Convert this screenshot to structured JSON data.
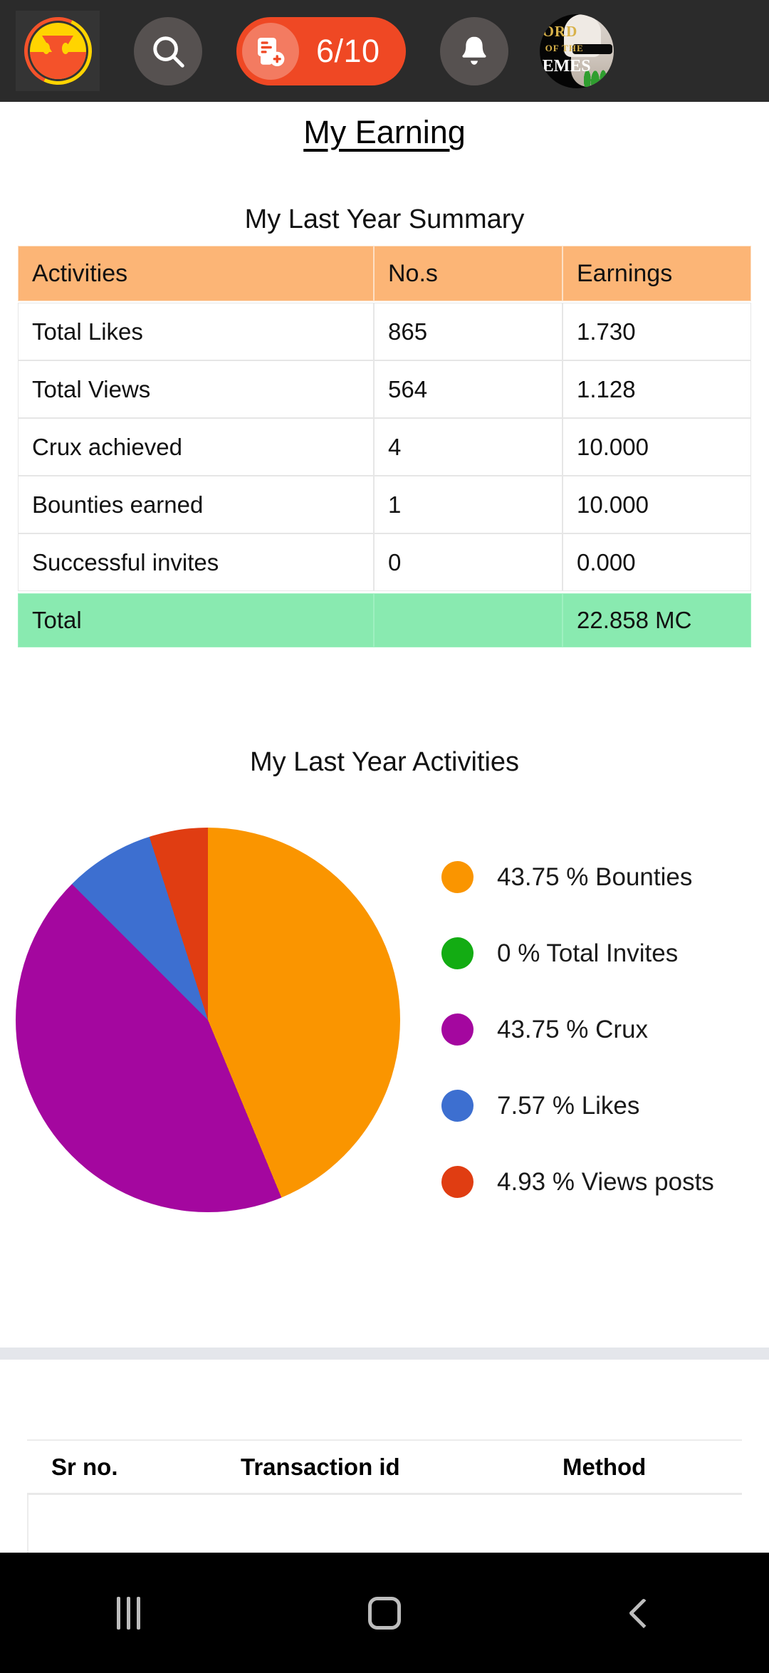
{
  "appbar": {
    "logo_name": "app-logo-owl",
    "search_icon": "search-icon",
    "post_icon": "add-post-icon",
    "post_count": "6/10",
    "bell_icon": "notification-bell-icon",
    "avatar_line1": "ORD",
    "avatar_line2": "OF THE",
    "avatar_line3": "EMES"
  },
  "page": {
    "title": "My Earning",
    "summary_heading": "My Last Year Summary",
    "activities_heading": "My Last Year Activities"
  },
  "summary_table": {
    "columns": [
      "Activities",
      "No.s",
      "Earnings"
    ],
    "rows": [
      {
        "activity": "Total Likes",
        "nos": "865",
        "earnings": "1.730"
      },
      {
        "activity": "Total Views",
        "nos": "564",
        "earnings": "1.128"
      },
      {
        "activity": "Crux achieved",
        "nos": "4",
        "earnings": "10.000"
      },
      {
        "activity": "Bounties earned",
        "nos": "1",
        "earnings": "10.000"
      },
      {
        "activity": "Successful invites",
        "nos": "0",
        "earnings": "0.000"
      }
    ],
    "total": {
      "label": "Total",
      "nos": "",
      "earnings": "22.858 MC"
    },
    "header_bg": "#fcb576",
    "total_bg": "#89eab0"
  },
  "chart_data": {
    "type": "pie",
    "title": "My Last Year Activities",
    "legend_position": "right",
    "categories": [
      "Bounties",
      "Total Invites",
      "Crux",
      "Likes",
      "Views posts"
    ],
    "values": [
      43.75,
      0,
      43.75,
      7.57,
      4.93
    ],
    "unit": "%",
    "colors": [
      "#fa9500",
      "#13ac13",
      "#a4079f",
      "#3d6fd0",
      "#e03d12"
    ],
    "legend": [
      {
        "label": "43.75 % Bounties",
        "value": 43.75,
        "color": "#fa9500"
      },
      {
        "label": "0 % Total Invites",
        "value": 0,
        "color": "#13ac13"
      },
      {
        "label": "43.75 % Crux",
        "value": 43.75,
        "color": "#a4079f"
      },
      {
        "label": "7.57 % Likes",
        "value": 7.57,
        "color": "#3d6fd0"
      },
      {
        "label": "4.93 % Views posts",
        "value": 4.93,
        "color": "#e03d12"
      }
    ],
    "slice_order": [
      "Bounties",
      "Crux",
      "Likes",
      "Views posts"
    ],
    "start_angle_deg": 0
  },
  "transactions_table": {
    "columns": [
      "Sr no.",
      "Transaction id",
      "Method"
    ],
    "rows": []
  },
  "navbar": {
    "recents": "recents-icon",
    "home": "home-icon",
    "back": "back-icon"
  }
}
